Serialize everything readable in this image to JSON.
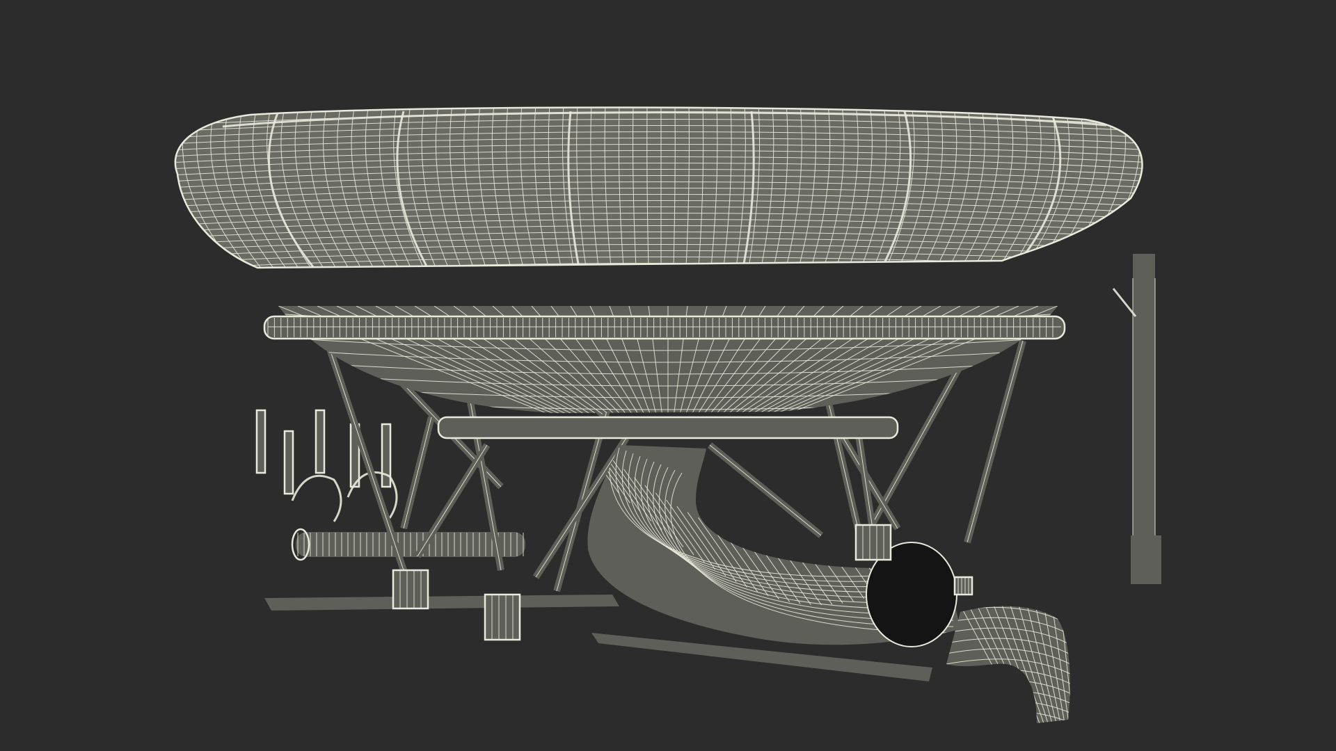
{
  "scene": {
    "subject": "water-slide-bowl-wireframe",
    "background_color": "#2c2c2c",
    "surface_color": "#5e5f58",
    "surface_light_color": "#6a6b63",
    "wire_color": "#e9e9dc",
    "shadow_color": "#1f1f1c",
    "render_style": "wireframe-over-shaded"
  }
}
